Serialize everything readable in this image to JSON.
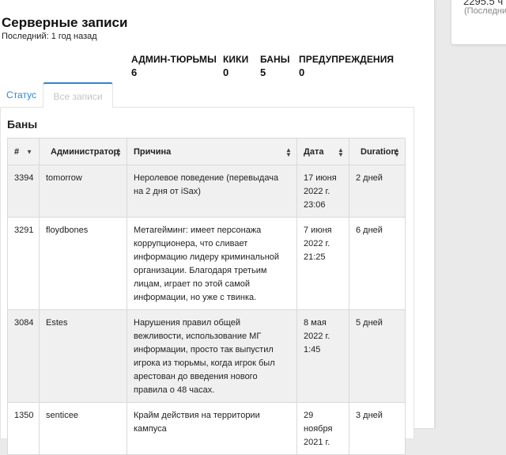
{
  "side_card": {
    "value_partial": "2295.5 ч",
    "subtitle_partial": "(Последний"
  },
  "header": {
    "title": "Серверные записи",
    "subtitle": "Последний: 1 год назад"
  },
  "stats": [
    {
      "label": "АДМИН-ТЮРЬМЫ",
      "value": "6"
    },
    {
      "label": "КИКИ",
      "value": "0"
    },
    {
      "label": "БАНЫ",
      "value": "5"
    },
    {
      "label": "ПРЕДУПРЕЖДЕНИЯ",
      "value": "0"
    }
  ],
  "tabs": [
    {
      "label": "Статус",
      "active": false
    },
    {
      "label": "Все записи",
      "active": true
    }
  ],
  "panel": {
    "title": "Баны"
  },
  "table": {
    "headers": [
      "#",
      "Администратор",
      "Причина",
      "Дата",
      "Duration"
    ],
    "rows": [
      {
        "id": "3394",
        "admin": "tomorrow",
        "reason": "Неролевое поведение (перевыдача на 2 дня от iSax)",
        "date": "17 июня 2022 г. 23:06",
        "duration": "2 дней"
      },
      {
        "id": "3291",
        "admin": "floydbones",
        "reason": "Метагейминг: имеет персонажа коррупционера, что сливает информацию лидеру криминальной организации. Благодаря третьим лицам, играет по этой самой информации, но уже с твинка.",
        "date": "7 июня 2022 г. 21:25",
        "duration": "6 дней"
      },
      {
        "id": "3084",
        "admin": "Estes",
        "reason": "Нарушения правил общей вежливости, использование МГ информации, просто так выпустил игрока из тюрьмы, когда игрок был арестован до введения нового правила о 48 часах.",
        "date": "8 мая 2022 г. 1:45",
        "duration": "5 дней"
      },
      {
        "id": "1350",
        "admin": "senticee",
        "reason": "Крайм действия на территории кампуса",
        "date": "29 ноября 2021 г.",
        "duration": "3 дней"
      }
    ]
  }
}
